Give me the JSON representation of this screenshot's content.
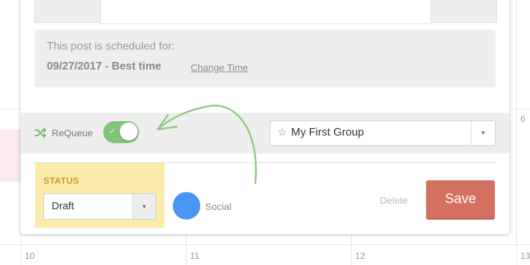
{
  "calendar": {
    "day_numbers": [
      "6",
      "10",
      "11",
      "12",
      "13"
    ]
  },
  "schedule": {
    "label": "This post is scheduled for:",
    "date_text": "09/27/2017 - Best time",
    "change_time_label": "Change Time"
  },
  "requeue": {
    "label": "ReQueue",
    "enabled": true,
    "toggle_color": "#82c47a",
    "icon": "shuffle-icon"
  },
  "group_select": {
    "icon": "star-icon",
    "selected": "My First Group"
  },
  "status": {
    "title": "STATUS",
    "selected": "Draft",
    "panel_color": "#fcebaa"
  },
  "social": {
    "label": "Social",
    "color": "#4a94f3"
  },
  "actions": {
    "delete_label": "Delete",
    "save_label": "Save",
    "save_color": "#d56f5f"
  },
  "annotation": {
    "arrow_color": "#8cc97e"
  }
}
